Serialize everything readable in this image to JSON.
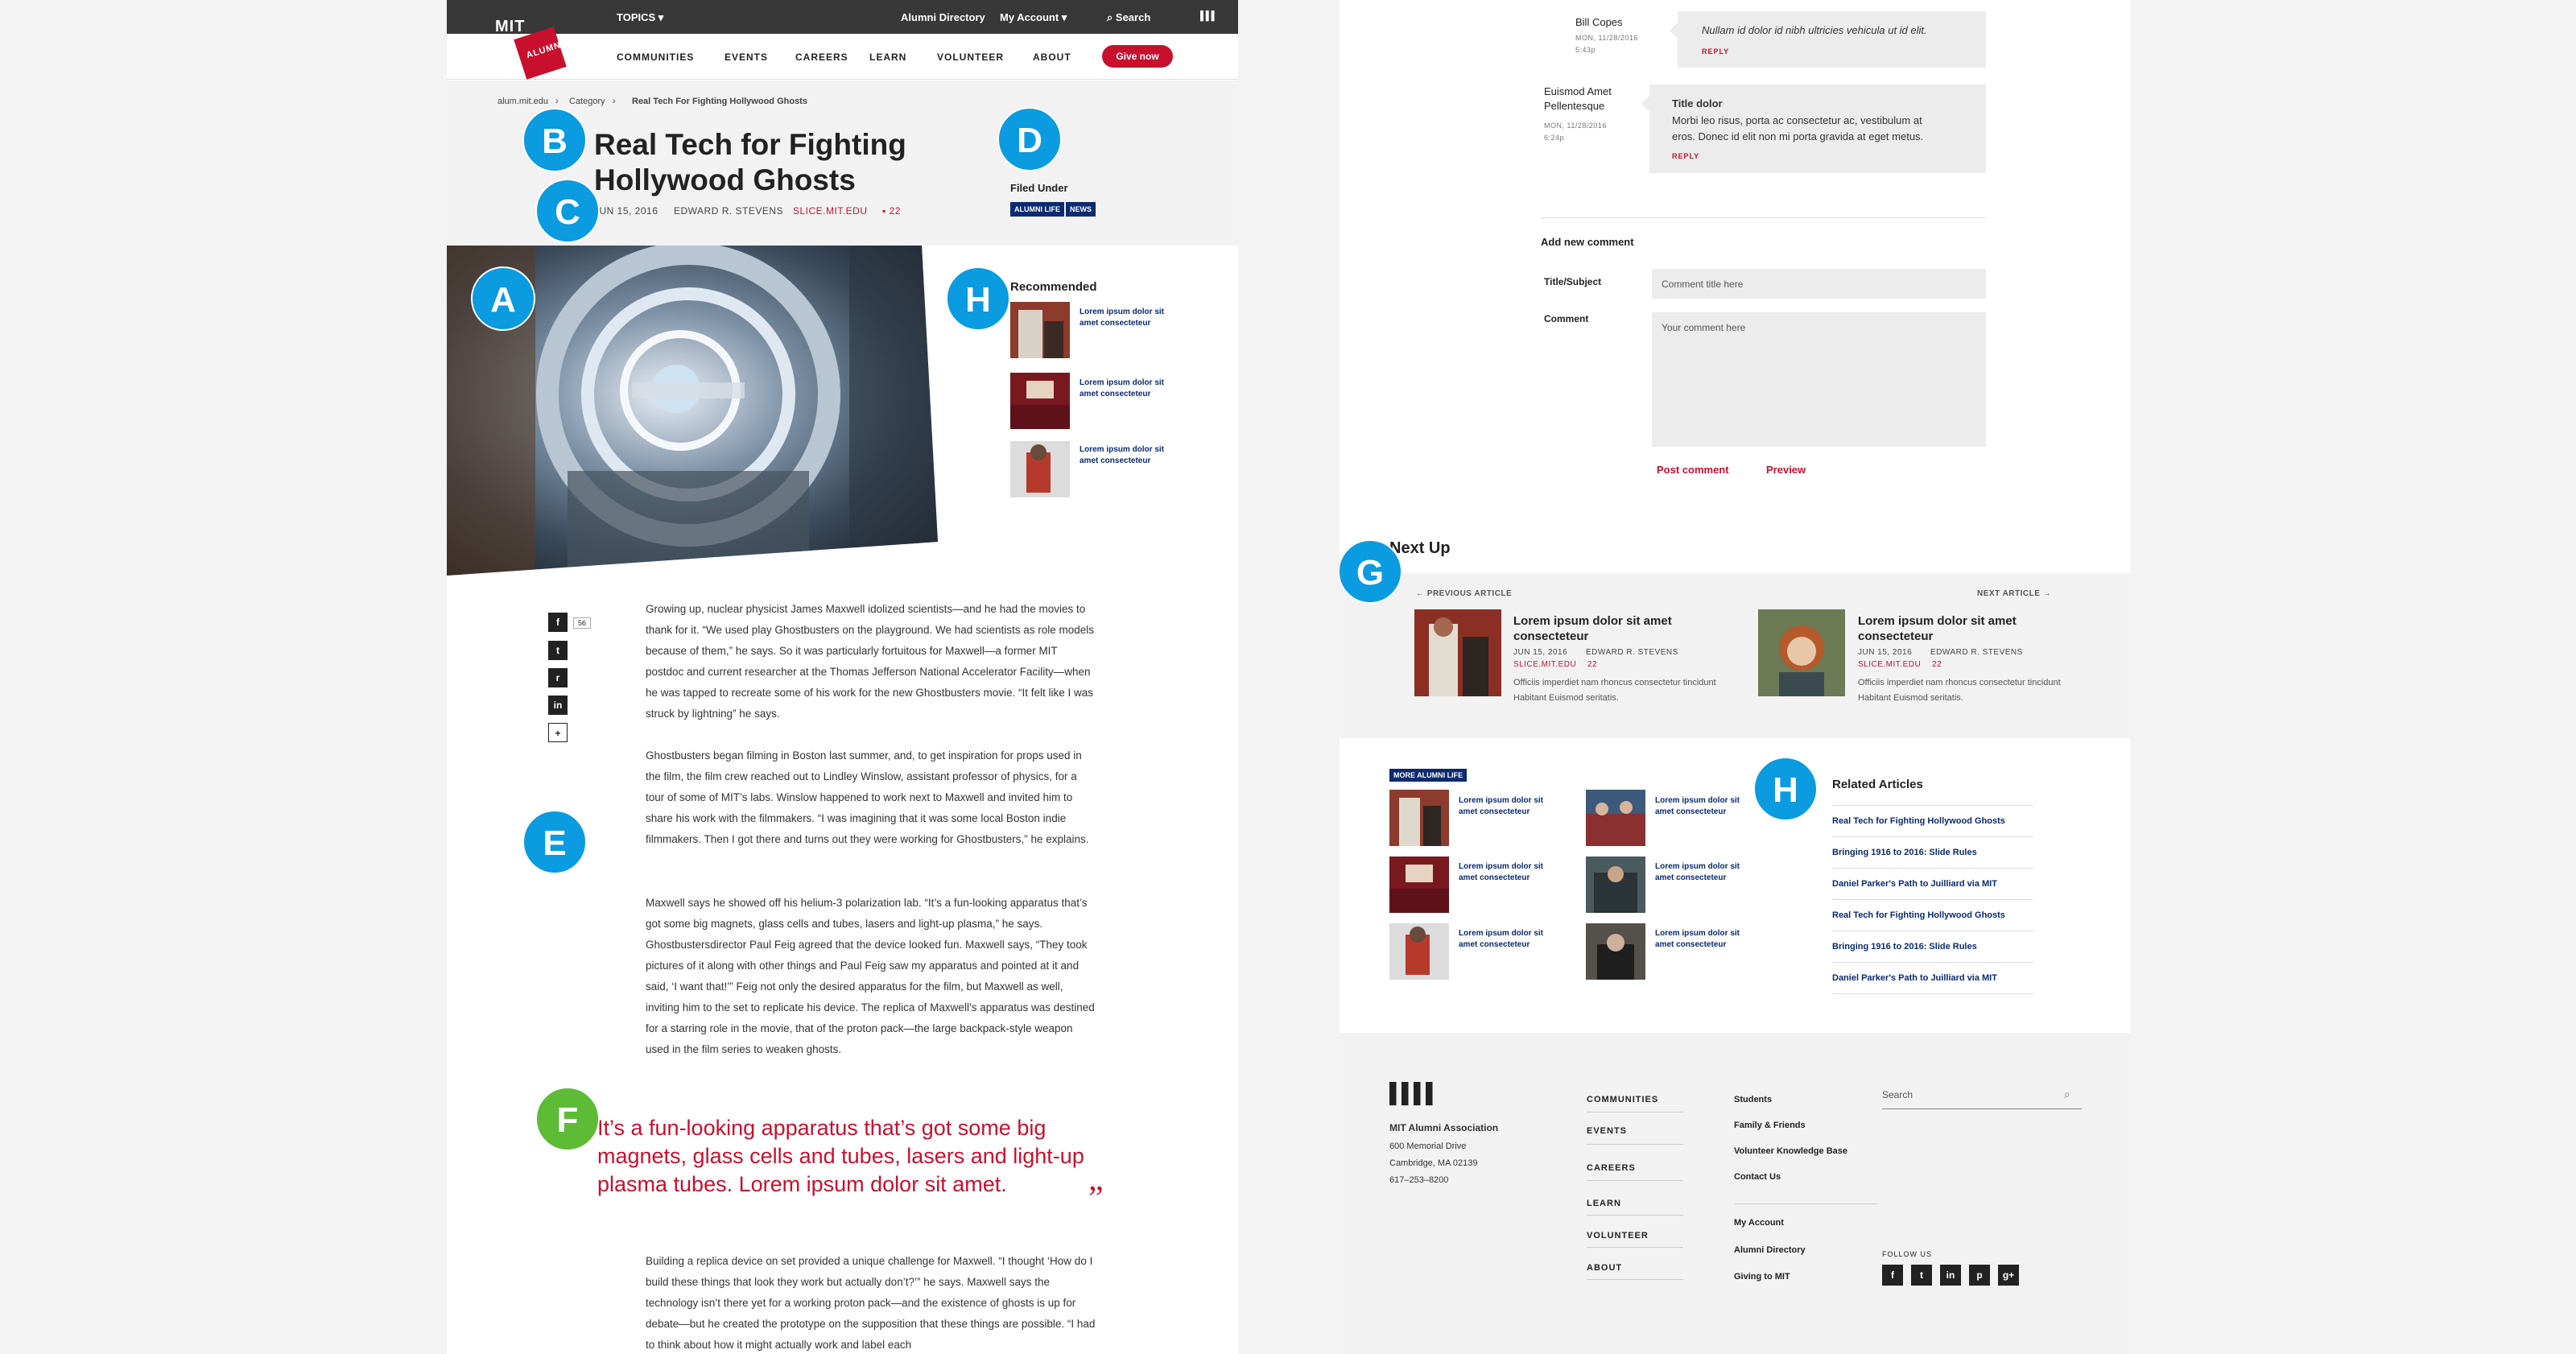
{
  "header": {
    "logo_mit": "MIT",
    "logo_alumni": "ALUMNI",
    "topics": "TOPICS ▾",
    "directory": "Alumni Directory",
    "account": "My Account ▾",
    "search": "Search",
    "nav": [
      "COMMUNITIES",
      "EVENTS",
      "CAREERS",
      "LEARN",
      "VOLUNTEER",
      "ABOUT"
    ],
    "give": "Give now"
  },
  "breadcrumb": {
    "home": "alum.mit.edu",
    "category": "Category",
    "current": "Real Tech For Fighting Hollywood Ghosts"
  },
  "article": {
    "title": "Real Tech for Fighting Hollywood Ghosts",
    "date": "JUN 15, 2016",
    "author": "EDWARD R. STEVENS",
    "source": "SLICE.MIT.EDU",
    "comments": "22",
    "filed_label": "Filed Under",
    "tags": [
      "ALUMNI LIFE",
      "NEWS"
    ]
  },
  "badges": {
    "a": "A",
    "b": "B",
    "c": "C",
    "d": "D",
    "e": "E",
    "f": "F",
    "g": "G",
    "h1": "H",
    "h2": "H"
  },
  "recommended": {
    "heading": "Recommended",
    "items": [
      "Lorem ipsum dolor sit amet consecteteur",
      "Lorem ipsum dolor sit amet consecteteur",
      "Lorem ipsum dolor sit amet consecteteur"
    ]
  },
  "share": {
    "count": "56"
  },
  "body": {
    "p1": "Growing up, nuclear physicist James Maxwell idolized scientists—and he had the movies to thank for it. “We used play Ghostbusters on the playground. We had scientists as role models because of them,” he says. So it was particularly fortuitous for Maxwell—a former MIT postdoc and current researcher at the Thomas Jefferson National Accelerator Facility—when he was tapped to recreate some of his work for the new Ghostbusters movie. “It felt like I was struck by lightning” he says.",
    "p2": "Ghostbusters began filming in Boston last summer, and, to get inspiration for props used in the film, the film crew reached out to Lindley Winslow, assistant professor of physics, for a tour of some of MIT’s labs. Winslow happened to work next to Maxwell and invited him to share his work with the filmmakers.  “I was imagining that it was some local Boston indie filmmakers. Then I got there and turns out they were working for Ghostbusters,” he explains.",
    "p3": "Maxwell says he showed off his helium-3 polarization lab. “It’s a fun-looking apparatus that’s got some big magnets, glass cells and tubes, lasers and light-up plasma,” he says. Ghostbustersdirector Paul Feig agreed that the device looked fun. Maxwell says, “They took pictures of it along with other things and Paul Feig saw my apparatus and pointed at it and said, ‘I want that!’” Feig not only the desired apparatus for the film, but Maxwell as well, inviting him to the set to replicate his device. The replica of Maxwell’s apparatus was destined for a starring role in the movie, that of the proton pack—the large backpack-style weapon used in the film series to weaken ghosts.",
    "quote": "It’s a fun-looking apparatus that’s got some big magnets, glass cells and tubes, lasers and light-up plasma tubes.  Lorem ipsum dolor sit amet.",
    "quote_mark": "”",
    "p4": "Building a replica device on set provided a unique challenge for Maxwell. “I thought ‘How do I build these things that look they work but actually don’t?’” he says. Maxwell says the technology isn’t there yet for a working proton pack—and the existence of ghosts is up for debate—but he created the prototype on the supposition that these things are possible. “I had to think about how it might actually work and label each"
  },
  "comments": [
    {
      "name": "Bill Copes",
      "date": "MON, 11/28/2016",
      "time": "5:43p",
      "text": "Nullam id dolor id nibh ultricies vehicula ut id elit.",
      "reply": "REPLY"
    },
    {
      "name": "Euismod Amet Pellentesque",
      "date": "MON, 11/28/2016",
      "time": "6:24p",
      "title": "Title dolor",
      "text": "Morbi leo risus, porta ac consectetur ac, vestibulum at eros. Donec id elit non mi porta gravida at eget metus.",
      "reply": "REPLY"
    }
  ],
  "comment_form": {
    "heading": "Add new comment",
    "title_label": "Title/Subject",
    "title_placeholder": "Comment title here",
    "comment_label": "Comment",
    "comment_placeholder": "Your comment here",
    "post": "Post comment",
    "preview": "Preview"
  },
  "next_up": {
    "heading": "Next Up",
    "prev_label": "PREVIOUS ARTICLE",
    "next_label": "NEXT ARTICLE",
    "items": [
      {
        "title": "Lorem ipsum dolor sit amet consecteteur",
        "date": "JUN 15, 2016",
        "author": "EDWARD R. STEVENS",
        "source": "SLICE.MIT.EDU",
        "comments": "22",
        "desc": "Officiis imperdiet nam rhoncus consectetur tincidunt Habitant Euismod seritatis."
      },
      {
        "title": "Lorem ipsum dolor sit amet consecteteur",
        "date": "JUN 15, 2016",
        "author": "EDWARD R. STEVENS",
        "source": "SLICE.MIT.EDU",
        "comments": "22",
        "desc": "Officiis imperdiet nam rhoncus consectetur tincidunt Habitant Euismod seritatis."
      }
    ]
  },
  "more_alumni": {
    "label": "MORE ALUMNI LIFE",
    "items": [
      "Lorem ipsum dolor sit amet consecteteur",
      "Lorem ipsum dolor sit amet consecteteur",
      "Lorem ipsum dolor sit amet consecteteur",
      "Lorem ipsum dolor sit amet consecteteur",
      "Lorem ipsum dolor sit amet consecteteur",
      "Lorem ipsum dolor sit amet consecteteur"
    ]
  },
  "related": {
    "heading": "Related Articles",
    "items": [
      "Real Tech for Fighting Hollywood Ghosts",
      "Bringing 1916 to 2016: Slide Rules",
      "Daniel Parker's Path to Juilliard via MIT",
      "Real Tech for Fighting Hollywood Ghosts",
      "Bringing 1916 to 2016: Slide Rules",
      "Daniel Parker's Path to Juilliard via MIT"
    ]
  },
  "footer": {
    "org": "MIT Alumni Association",
    "addr1": "600 Memorial Drive",
    "addr2": "Cambridge, MA 02139",
    "phone": "617–253–8200",
    "col1": [
      "COMMUNITIES",
      "EVENTS",
      "CAREERS",
      "LEARN",
      "VOLUNTEER",
      "ABOUT"
    ],
    "col2": [
      "Students",
      "Family & Friends",
      "Volunteer Knowledge Base",
      "Contact Us",
      "My Account",
      "Alumni Directory",
      "Giving to MIT"
    ],
    "search_placeholder": "Search",
    "follow": "FOLLOW US"
  },
  "social_icons": [
    "f",
    "t",
    "r",
    "in",
    "+"
  ],
  "footer_social": [
    "f",
    "t",
    "in",
    "p",
    "g+"
  ],
  "colors": {
    "accent": "#c8102e",
    "navy": "#0b2a6f",
    "badge": "#0a9be0",
    "badge_green": "#5dbb35"
  }
}
